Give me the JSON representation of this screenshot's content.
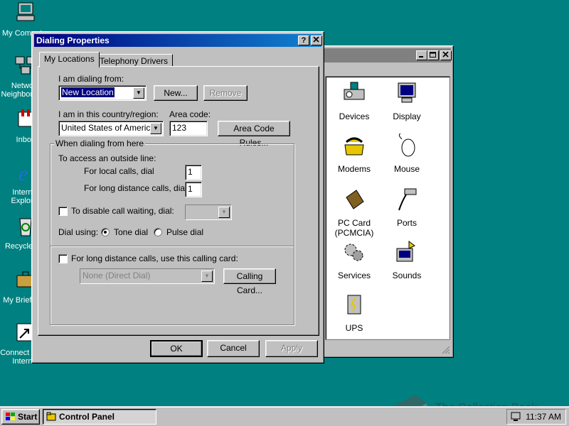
{
  "desktop": {
    "icons": [
      {
        "label": "My Computer",
        "icon": "my-computer-icon"
      },
      {
        "label": "Network Neighborhood",
        "icon": "network-icon"
      },
      {
        "label": "Inbox",
        "icon": "inbox-icon"
      },
      {
        "label": "Internet Explorer",
        "icon": "ie-icon"
      },
      {
        "label": "Recycle Bin",
        "icon": "recycle-bin-icon"
      },
      {
        "label": "My Briefcase",
        "icon": "briefcase-icon"
      },
      {
        "label": "Connect to the Internet",
        "icon": "connect-icon"
      }
    ]
  },
  "control_panel": {
    "items": [
      {
        "label": "Devices",
        "icon": "devices-icon"
      },
      {
        "label": "Display",
        "icon": "display-icon"
      },
      {
        "label": "Modems",
        "icon": "modem-icon"
      },
      {
        "label": "Mouse",
        "icon": "mouse-icon"
      },
      {
        "label": "PC Card (PCMCIA)",
        "icon": "pc-card-icon"
      },
      {
        "label": "Ports",
        "icon": "ports-icon"
      },
      {
        "label": "Services",
        "icon": "services-icon"
      },
      {
        "label": "Sounds",
        "icon": "sounds-icon"
      },
      {
        "label": "UPS",
        "icon": "ups-icon"
      }
    ]
  },
  "dialog": {
    "title": "Dialing Properties",
    "help_button": "?",
    "close_button": "✕",
    "tabs": [
      {
        "label": "My Locations"
      },
      {
        "label": "Telephony Drivers"
      }
    ],
    "dialing_from_label": "I am dialing from:",
    "dialing_from_value": "New Location",
    "new_button": "New...",
    "remove_button": "Remove",
    "country_label": "I am in this country/region:",
    "country_value": "United States of America",
    "area_code_label": "Area code:",
    "area_code_value": "123",
    "area_code_rules_button": "Area Code Rules...",
    "group_title": "When dialing from here",
    "outside_line_label": "To access an outside line:",
    "local_calls_label": "For local calls, dial",
    "local_calls_value": "1",
    "long_distance_label": "For long distance calls, dial",
    "long_distance_value": "1",
    "call_waiting_label": "To disable call waiting, dial:",
    "dial_using_label": "Dial using:",
    "tone_dial_label": "Tone dial",
    "pulse_dial_label": "Pulse dial",
    "calling_card_label": "For long distance calls, use this calling card:",
    "calling_card_value": "None (Direct Dial)",
    "calling_card_button": "Calling Card...",
    "ok_button": "OK",
    "cancel_button": "Cancel",
    "apply_button": "Apply"
  },
  "taskbar": {
    "start_label": "Start",
    "task_label": "Control Panel",
    "clock": "11:37 AM"
  },
  "watermark": {
    "text": "The Collection Book"
  }
}
